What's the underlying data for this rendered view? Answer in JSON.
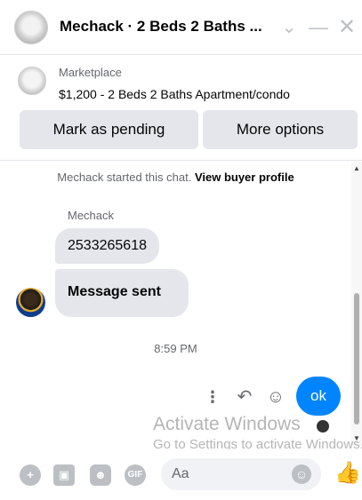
{
  "header": {
    "title": "Mechack · 2 Beds 2 Baths ...",
    "icons": [
      "chevron-down-icon",
      "minimize-icon",
      "close-icon"
    ]
  },
  "listing": {
    "source": "Marketplace",
    "description": "$1,200 - 2 Beds 2 Baths Apartment/condo",
    "primary_button": "Mark as pending",
    "secondary_button": "More options"
  },
  "chat": {
    "started_text": "Mechack started this chat.",
    "view_profile_link": "View buyer profile",
    "sender_name": "Mechack",
    "messages": [
      {
        "text": "2533265618"
      },
      {
        "text": "Message sent"
      }
    ],
    "timestamp": "8:59 PM",
    "my_message": "ok",
    "message_actions": [
      "more-icon",
      "reply-icon",
      "react-icon"
    ]
  },
  "watermark": {
    "title": "Activate Windows",
    "subtitle": "Go to Settings to activate Windows."
  },
  "composer": {
    "placeholder": "Aa",
    "icons": [
      "add-icon",
      "photo-icon",
      "sticker-icon",
      "gif-icon",
      "emoji-icon",
      "like-icon"
    ],
    "gif_label": "GIF"
  },
  "colors": {
    "accent": "#0084ff",
    "bubble": "#e4e6eb",
    "muted_text": "#65676b",
    "icon_gray": "#bcc0c4"
  }
}
